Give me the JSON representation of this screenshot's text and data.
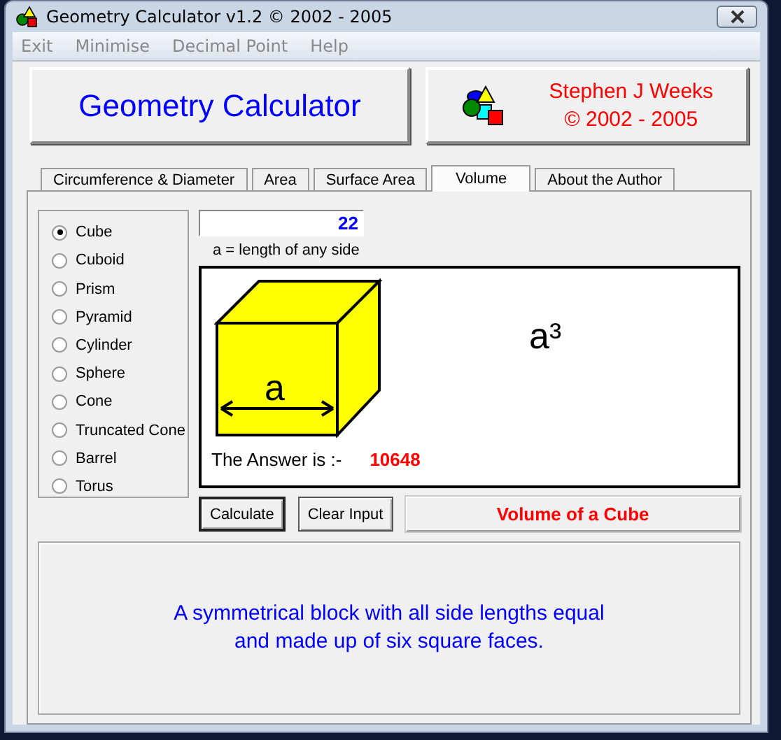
{
  "window": {
    "title": "Geometry Calculator v1.2 ©  2002 - 2005"
  },
  "menu": [
    "Exit",
    "Minimise",
    "Decimal Point",
    "Help"
  ],
  "header": {
    "title": "Geometry Calculator",
    "author": "Stephen J Weeks\n© 2002 - 2005"
  },
  "tabs": [
    {
      "label": "Circumference & Diameter",
      "selected": false
    },
    {
      "label": "Area",
      "selected": false
    },
    {
      "label": "Surface Area",
      "selected": false
    },
    {
      "label": "Volume",
      "selected": true
    },
    {
      "label": "About the Author",
      "selected": false
    }
  ],
  "shapes": [
    {
      "label": "Cube",
      "selected": true
    },
    {
      "label": "Cuboid",
      "selected": false
    },
    {
      "label": "Prism",
      "selected": false
    },
    {
      "label": "Pyramid",
      "selected": false
    },
    {
      "label": "Cylinder",
      "selected": false
    },
    {
      "label": "Sphere",
      "selected": false
    },
    {
      "label": "Cone",
      "selected": false
    },
    {
      "label": "Truncated Cone",
      "selected": false
    },
    {
      "label": "Barrel",
      "selected": false
    },
    {
      "label": "Torus",
      "selected": false
    }
  ],
  "input": {
    "value": "22",
    "caption": "a = length of any side"
  },
  "diagram": {
    "side_label": "a",
    "formula": "a³"
  },
  "result": {
    "label": "The Answer is :-",
    "answer": "10648"
  },
  "buttons": [
    "Calculate",
    "Clear Input"
  ],
  "shape_title": "Volume of a Cube",
  "description": "A symmetrical block with all side lengths equal\nand made up of six square faces."
}
